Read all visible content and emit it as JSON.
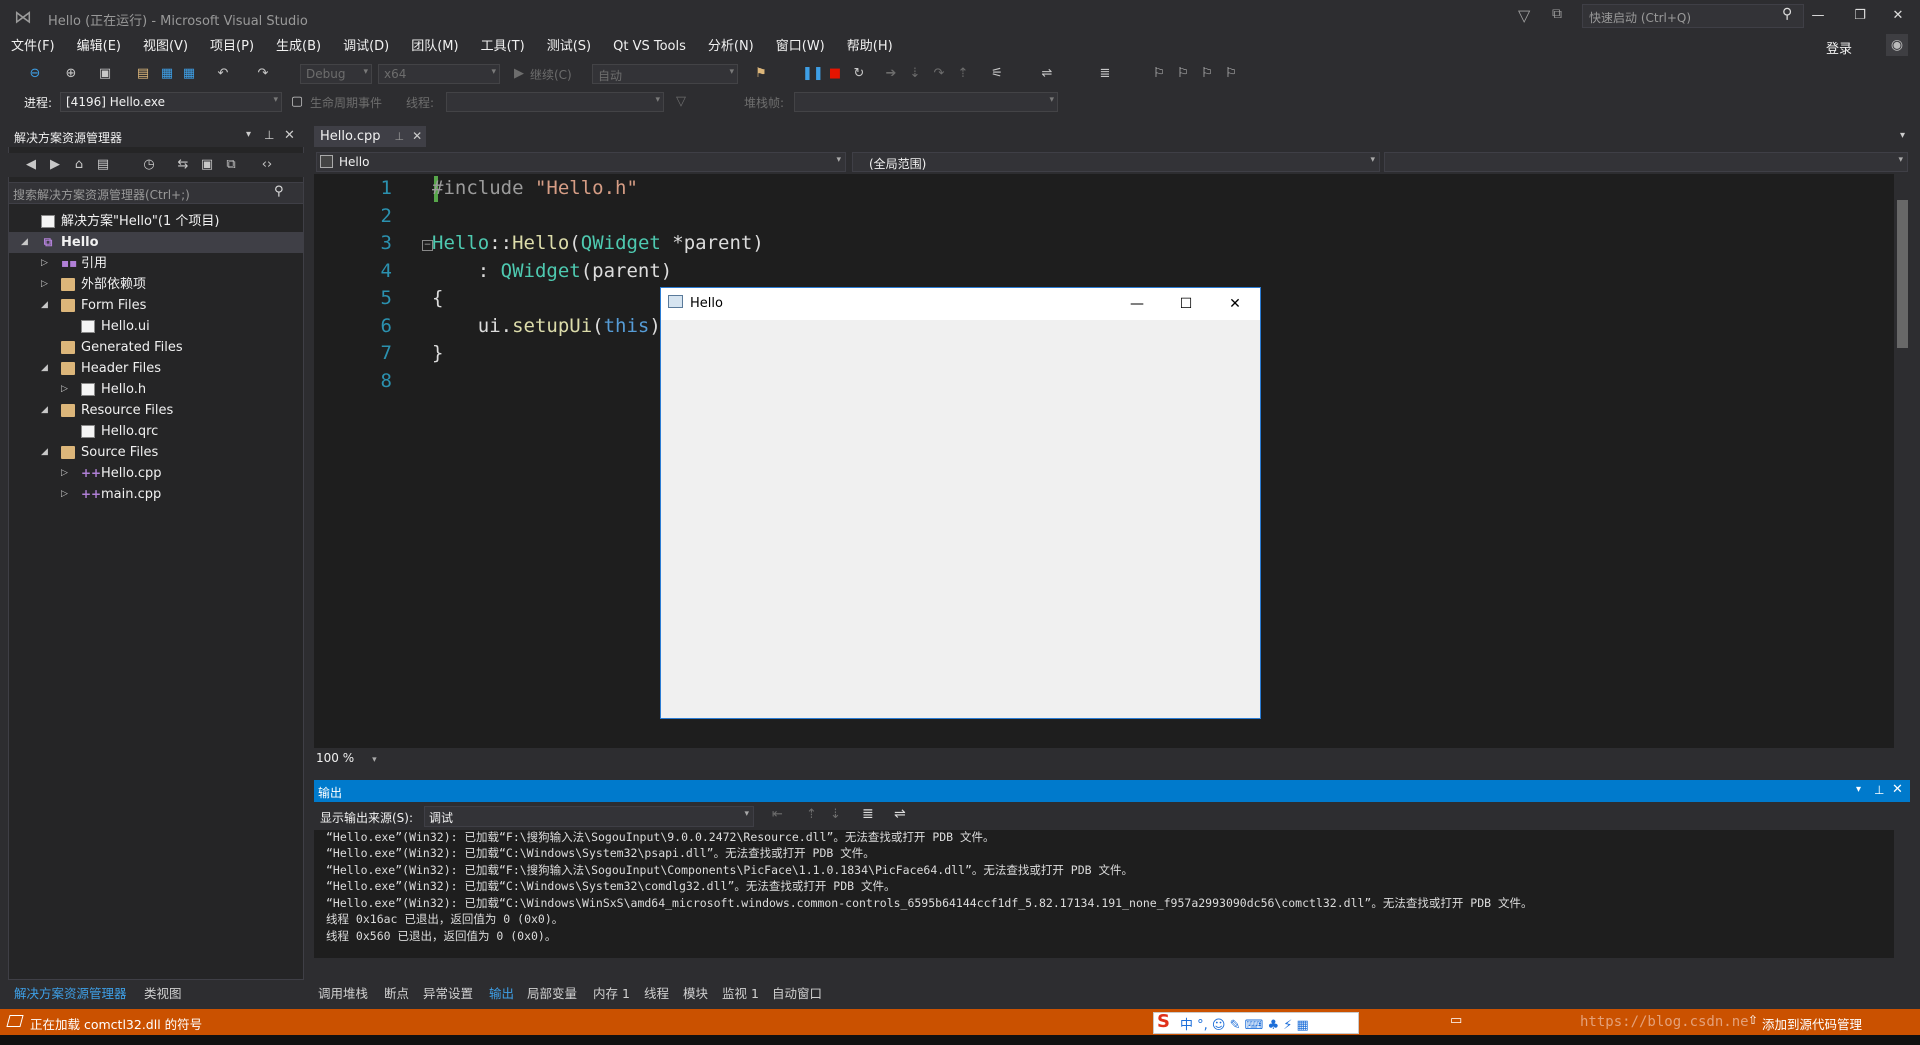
{
  "window": {
    "title": "Hello (正在运行) - Microsoft Visual Studio",
    "quick_launch_placeholder": "快速启动 (Ctrl+Q)",
    "sign_in": "登录"
  },
  "menu": [
    "文件(F)",
    "编辑(E)",
    "视图(V)",
    "项目(P)",
    "生成(B)",
    "调试(D)",
    "团队(M)",
    "工具(T)",
    "测试(S)",
    "Qt VS Tools",
    "分析(N)",
    "窗口(W)",
    "帮助(H)"
  ],
  "toolbar": {
    "config": "Debug",
    "platform": "x64",
    "continue": "继续(C)",
    "auto": "自动",
    "process_label": "进程:",
    "process_value": "[4196] Hello.exe",
    "lifecycle_label": "生命周期事件",
    "thread_label": "线程:",
    "stackframe_label": "堆栈帧:"
  },
  "solution_explorer": {
    "title": "解决方案资源管理器",
    "search_placeholder": "搜索解决方案资源管理器(Ctrl+;)",
    "tree": [
      {
        "label": "解决方案\"Hello\"(1 个项目)",
        "level": 0,
        "arrow": "",
        "icon": "solution"
      },
      {
        "label": "Hello",
        "level": 0,
        "arrow": "◢",
        "icon": "project",
        "selected": true
      },
      {
        "label": "引用",
        "level": 1,
        "arrow": "▷",
        "icon": "ref"
      },
      {
        "label": "外部依赖项",
        "level": 1,
        "arrow": "▷",
        "icon": "extdep"
      },
      {
        "label": "Form Files",
        "level": 1,
        "arrow": "◢",
        "icon": "folder"
      },
      {
        "label": "Hello.ui",
        "level": 2,
        "arrow": "",
        "icon": "file"
      },
      {
        "label": "Generated Files",
        "level": 1,
        "arrow": "",
        "icon": "folder"
      },
      {
        "label": "Header Files",
        "level": 1,
        "arrow": "◢",
        "icon": "folder"
      },
      {
        "label": "Hello.h",
        "level": 2,
        "arrow": "▷",
        "icon": "file"
      },
      {
        "label": "Resource Files",
        "level": 1,
        "arrow": "◢",
        "icon": "folder"
      },
      {
        "label": "Hello.qrc",
        "level": 2,
        "arrow": "",
        "icon": "file"
      },
      {
        "label": "Source Files",
        "level": 1,
        "arrow": "◢",
        "icon": "folder"
      },
      {
        "label": "Hello.cpp",
        "level": 2,
        "arrow": "▷",
        "icon": "cpp"
      },
      {
        "label": "main.cpp",
        "level": 2,
        "arrow": "▷",
        "icon": "cpp"
      }
    ],
    "bottom_tabs": [
      "解决方案资源管理器",
      "类视图"
    ]
  },
  "editor": {
    "tab": "Hello.cpp",
    "nav_left": "Hello",
    "nav_right": "(全局范围)",
    "zoom": "100 %",
    "line_numbers": [
      "1",
      "2",
      "3",
      "4",
      "5",
      "6",
      "7",
      "8"
    ]
  },
  "hello_window": {
    "title": "Hello"
  },
  "output": {
    "title": "输出",
    "source_label": "显示输出来源(S):",
    "source_value": "调试",
    "lines": [
      "“Hello.exe”(Win32): 已加载“F:\\搜狗输入法\\SogouInput\\9.0.0.2472\\Resource.dll”。无法查找或打开 PDB 文件。",
      "“Hello.exe”(Win32): 已加载“C:\\Windows\\System32\\psapi.dll”。无法查找或打开 PDB 文件。",
      "“Hello.exe”(Win32): 已加载“F:\\搜狗输入法\\SogouInput\\Components\\PicFace\\1.1.0.1834\\PicFace64.dll”。无法查找或打开 PDB 文件。",
      "“Hello.exe”(Win32): 已加载“C:\\Windows\\System32\\comdlg32.dll”。无法查找或打开 PDB 文件。",
      "“Hello.exe”(Win32): 已加载“C:\\Windows\\WinSxS\\amd64_microsoft.windows.common-controls_6595b64144ccf1df_5.82.17134.191_none_f957a2993090dc56\\comctl32.dll”。无法查找或打开 PDB 文件。",
      "线程 0x16ac 已退出，返回值为 0 (0x0)。",
      "线程 0x560 已退出，返回值为 0 (0x0)。"
    ]
  },
  "bottom_tabs": [
    "调用堆栈",
    "断点",
    "异常设置",
    "输出",
    "局部变量",
    "内存 1",
    "线程",
    "模块",
    "监视 1",
    "自动窗口"
  ],
  "status": {
    "text": "正在加载 comctl32.dll 的符号",
    "watermark": "https://blog.csdn.ne",
    "add_source": "添加到源代码管理"
  },
  "colors": {
    "accent": "#007acc",
    "status_bar": "#ca5100",
    "editor_bg": "#1e1e1e"
  }
}
